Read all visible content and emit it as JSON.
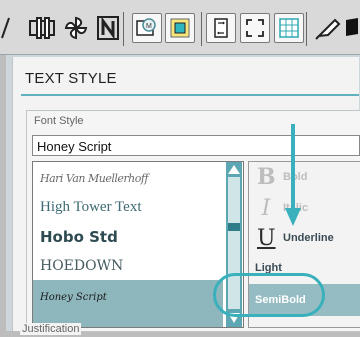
{
  "toolbar": {
    "tools": [
      {
        "icon": "slash-icon"
      },
      {
        "icon": "align-center-icon"
      },
      {
        "icon": "pinwheel-icon"
      },
      {
        "icon": "text-edit-icon"
      },
      {
        "icon": "screen-mode-icon"
      },
      {
        "icon": "fill-color-icon"
      },
      {
        "icon": "page-swap-icon"
      },
      {
        "icon": "fit-to-screen-icon"
      },
      {
        "icon": "grid-icon"
      },
      {
        "icon": "highlighter-icon"
      },
      {
        "icon": "eraser-icon"
      }
    ]
  },
  "panel": {
    "title": "TEXT STYLE",
    "font_style": {
      "label": "Font Style",
      "value": "Honey Script",
      "fonts": [
        {
          "label": "Hari Van Muellerhoff"
        },
        {
          "label": "High Tower Text"
        },
        {
          "label": "Hobo Std"
        },
        {
          "label": "HOEDOWN"
        },
        {
          "label": "Honey Script",
          "selected": true
        }
      ]
    },
    "styles": [
      {
        "icon": "B",
        "label": "Bold",
        "enabled": false
      },
      {
        "icon": "I",
        "label": "Italic",
        "enabled": false
      },
      {
        "icon": "U",
        "label": "Underline",
        "enabled": true
      },
      {
        "icon": "",
        "label": "Light",
        "enabled": true
      },
      {
        "icon": "",
        "label": "SemiBold",
        "enabled": true,
        "selected": true
      }
    ],
    "next_group": {
      "label": "Justification"
    }
  },
  "colors": {
    "accent": "#39b0bb",
    "selection": "#8eb6bd",
    "disabled_text": "#b6b6b6",
    "enabled_text": "#3a4b55"
  }
}
